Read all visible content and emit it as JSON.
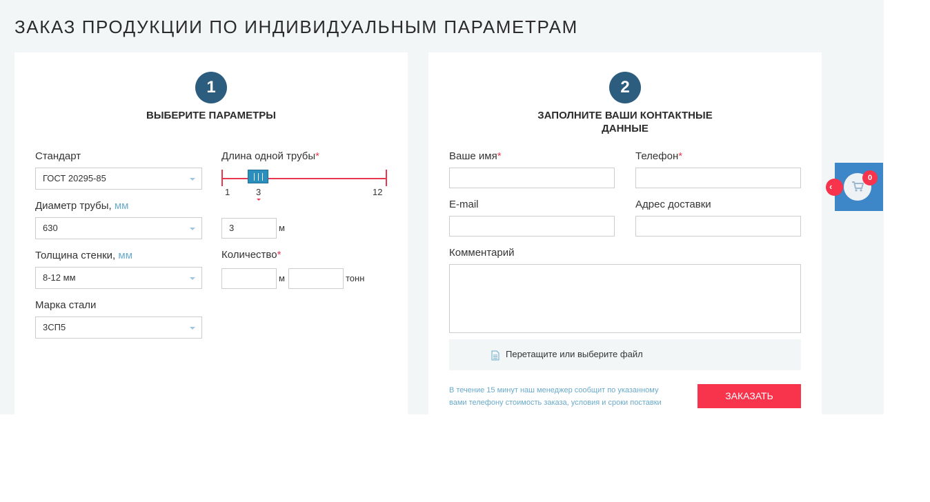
{
  "page_title": "ЗАКАЗ ПРОДУКЦИИ ПО ИНДИВИДУАЛЬНЫМ ПАРАМЕТРАМ",
  "step1": {
    "number": "1",
    "title": "ВЫБЕРИТЕ ПАРАМЕТРЫ",
    "standard": {
      "label": "Стандарт",
      "value": "ГОСТ 20295-85"
    },
    "diameter": {
      "label": "Диаметр трубы,",
      "unit": "мм",
      "value": "630"
    },
    "thickness": {
      "label": "Толщина стенки,",
      "unit": "мм",
      "value": "8-12 мм"
    },
    "steel": {
      "label": "Марка стали",
      "value": "3СП5"
    },
    "length": {
      "label": "Длина одной трубы",
      "required_mark": "*",
      "slider_min": "1",
      "slider_value": "3",
      "slider_max": "12",
      "input_value": "3",
      "unit": "м"
    },
    "quantity": {
      "label": "Количество",
      "required_mark": "*",
      "meters_unit": "м",
      "tons_unit": "тонн"
    }
  },
  "step2": {
    "number": "2",
    "title_line1": "ЗАПОЛНИТЕ ВАШИ КОНТАКТНЫЕ",
    "title_line2": "ДАННЫЕ",
    "name_label": "Ваше имя",
    "phone_label": "Телефон",
    "required_mark": "*",
    "email_label": "E-mail",
    "address_label": "Адрес доставки",
    "comment_label": "Комментарий",
    "dropzone_text": "Перетащите или выберите файл",
    "note_line1": "В течение 15 минут наш менеджер сообщит по указанному",
    "note_line2": "вами телефону стоимость заказа, условия и сроки поставки",
    "order_button": "ЗАКАЗАТЬ"
  },
  "cart": {
    "count": "0",
    "icon": "shopping-cart-icon",
    "toggle_icon": "chevron-left-icon"
  },
  "colors": {
    "accent_blue": "#2c5d7f",
    "accent_red": "#f7344c",
    "unit_blue": "#6aaac9",
    "cart_blue": "#3d86c8"
  }
}
